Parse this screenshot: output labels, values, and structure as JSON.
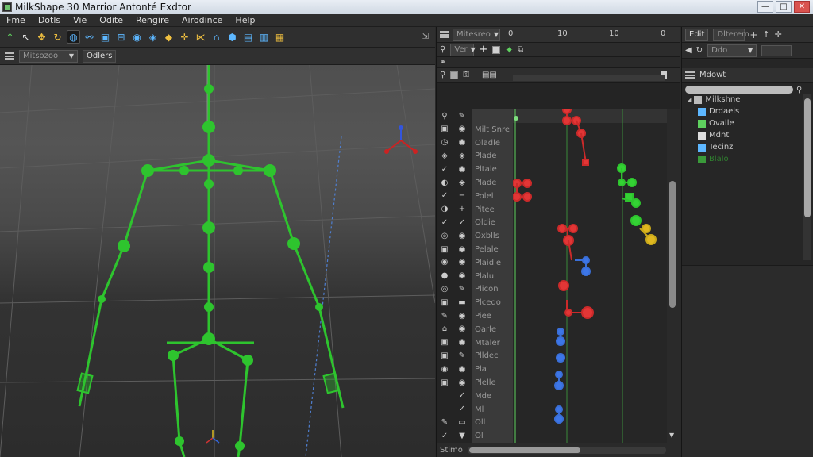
{
  "window": {
    "title": "MilkShape 30 Marrior Antonté Exdtor",
    "buttons": [
      "—",
      "□",
      "✕"
    ]
  },
  "menu": [
    "Fme",
    "Dotls",
    "Vie",
    "Odite",
    "Rengire",
    "Airodince",
    "Help"
  ],
  "toolbar": {
    "tools": [
      {
        "icon": "arrow-up-icon",
        "glyph": "↑",
        "color": "#5fd15f"
      },
      {
        "icon": "select-arrow-icon",
        "glyph": "↖",
        "color": "#e8e8e8"
      },
      {
        "icon": "move-icon",
        "glyph": "✥",
        "color": "#f0c040"
      },
      {
        "icon": "rotate-icon",
        "glyph": "↻",
        "color": "#f0c040"
      },
      {
        "icon": "joint-icon",
        "glyph": "◍",
        "color": "#5db7ff",
        "selected": true
      },
      {
        "icon": "link-icon",
        "glyph": "⚯",
        "color": "#5db7ff"
      },
      {
        "icon": "cube-icon",
        "glyph": "▣",
        "color": "#5db7ff"
      },
      {
        "icon": "cylinder-icon",
        "glyph": "⊞",
        "color": "#5db7ff"
      },
      {
        "icon": "sphere-icon",
        "glyph": "◉",
        "color": "#5db7ff"
      },
      {
        "icon": "geo-icon",
        "glyph": "◈",
        "color": "#5db7ff"
      },
      {
        "icon": "vertex-icon",
        "glyph": "◆",
        "color": "#f0c040"
      },
      {
        "icon": "bone-icon",
        "glyph": "✛",
        "color": "#f0c040"
      },
      {
        "icon": "weight-icon",
        "glyph": "⋉",
        "color": "#f0c040"
      },
      {
        "icon": "house-icon",
        "glyph": "⌂",
        "color": "#5db7ff"
      },
      {
        "icon": "box-icon",
        "glyph": "⬢",
        "color": "#5db7ff"
      },
      {
        "icon": "file-icon",
        "glyph": "▤",
        "color": "#5db7ff"
      },
      {
        "icon": "page-icon",
        "glyph": "▥",
        "color": "#5db7ff"
      },
      {
        "icon": "doc-icon",
        "glyph": "▦",
        "color": "#f0c040"
      }
    ],
    "corner": "⇲"
  },
  "viewport_bar": {
    "dropdown": "Mitsozoo",
    "button": "Odlers"
  },
  "timeline": {
    "dropdown": "Mitesreo",
    "ticks": [
      "0",
      "10",
      "10",
      "0"
    ],
    "row2_dropdown": "Ver",
    "tracks": [
      {
        "name": "",
        "ic1": "⚲",
        "ic2": "✎"
      },
      {
        "name": "Milt Snre",
        "ic1": "▣",
        "ic2": "◉"
      },
      {
        "name": "Oladle",
        "ic1": "◷",
        "ic2": "◉"
      },
      {
        "name": "Plade",
        "ic1": "◈",
        "ic2": "◈"
      },
      {
        "name": "Pltale",
        "ic1": "✓",
        "ic2": "◉"
      },
      {
        "name": "Plade",
        "ic1": "◐",
        "ic2": "◈"
      },
      {
        "name": "Polel",
        "ic1": "✓",
        "ic2": "−"
      },
      {
        "name": "Pitee",
        "ic1": "◑",
        "ic2": "+"
      },
      {
        "name": "Oldie",
        "ic1": "✓",
        "ic2": "✓"
      },
      {
        "name": "Oxblls",
        "ic1": "◎",
        "ic2": "◉"
      },
      {
        "name": "Pelale",
        "ic1": "▣",
        "ic2": "◉"
      },
      {
        "name": "Plaidle",
        "ic1": "◉",
        "ic2": "◉"
      },
      {
        "name": "Plalu",
        "ic1": "●",
        "ic2": "◉"
      },
      {
        "name": "Plicon",
        "ic1": "◎",
        "ic2": "✎"
      },
      {
        "name": "Plcedo",
        "ic1": "▣",
        "ic2": "▬"
      },
      {
        "name": "Piee",
        "ic1": "✎",
        "ic2": "◉"
      },
      {
        "name": "Oarle",
        "ic1": "⌂",
        "ic2": "◉"
      },
      {
        "name": "Mtaler",
        "ic1": "▣",
        "ic2": "◉"
      },
      {
        "name": "Plldec",
        "ic1": "▣",
        "ic2": "✎"
      },
      {
        "name": "Pla",
        "ic1": "◉",
        "ic2": "◉"
      },
      {
        "name": "Plelle",
        "ic1": "▣",
        "ic2": "◉"
      },
      {
        "name": "Mde",
        "ic1": "",
        "ic2": "✓"
      },
      {
        "name": "Ml",
        "ic1": "",
        "ic2": "✓"
      },
      {
        "name": "Oll",
        "ic1": "✎",
        "ic2": "▭"
      },
      {
        "name": "Ol",
        "ic1": "✓",
        "ic2": "▼"
      }
    ],
    "bottom_label": "Stimo"
  },
  "right_panel": {
    "tabs": [
      "Edit",
      "Dlterem"
    ],
    "row2_dropdown": "Ddo",
    "section_title": "Mdowt",
    "tree": [
      {
        "label": "Milkshne",
        "color": "#bbbbbb"
      },
      {
        "label": "Drdaels",
        "color": "#5db7ff"
      },
      {
        "label": "Ovalle",
        "color": "#5fd15f"
      },
      {
        "label": "Mdnt",
        "color": "#dddddd"
      },
      {
        "label": "Tecinz",
        "color": "#5db7ff"
      },
      {
        "label": "Blalo",
        "color": "#3a9a3a"
      }
    ]
  }
}
